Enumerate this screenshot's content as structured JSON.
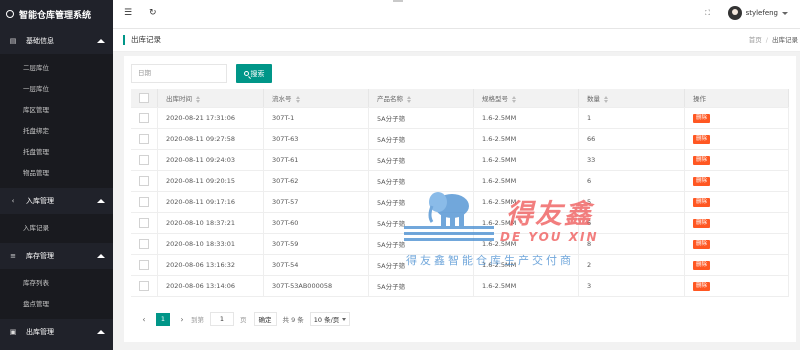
{
  "app": {
    "title": "智能仓库管理系统"
  },
  "sidebar": {
    "groups": [
      {
        "label": "基础信息",
        "icon": "document-icon",
        "items": [
          "二层库位",
          "一层库位",
          "库区管理",
          "托盘绑定",
          "托盘管理",
          "物品管理"
        ]
      },
      {
        "label": "入库管理",
        "icon": "chevron-left-icon",
        "items": [
          "入库记录"
        ]
      },
      {
        "label": "库存管理",
        "icon": "list-icon",
        "items": [
          "库存列表",
          "盘点管理"
        ]
      },
      {
        "label": "出库管理",
        "icon": "folder-icon",
        "items": []
      }
    ]
  },
  "topbar": {
    "menu_icon": "☰",
    "refresh_icon": "↻",
    "fullscreen_icon": "⛶",
    "user_name": "stylefeng"
  },
  "page": {
    "title": "出库记录",
    "breadcrumb": [
      "首页",
      "/",
      "出库记录"
    ]
  },
  "search": {
    "placeholder": "日期",
    "button_label": "搜索"
  },
  "table": {
    "columns": [
      "出库时间",
      "流水号",
      "产品名称",
      "规格型号",
      "数量",
      "操作"
    ],
    "action_label": "删除",
    "rows": [
      [
        "2020-08-21 17:31:06",
        "307T-1",
        "5A分子筛",
        "1.6-2.5MM",
        "1"
      ],
      [
        "2020-08-11 09:27:58",
        "307T-63",
        "5A分子筛",
        "1.6-2.5MM",
        "66"
      ],
      [
        "2020-08-11 09:24:03",
        "307T-61",
        "5A分子筛",
        "1.6-2.5MM",
        "33"
      ],
      [
        "2020-08-11 09:20:15",
        "307T-62",
        "5A分子筛",
        "1.6-2.5MM",
        "6"
      ],
      [
        "2020-08-11 09:17:16",
        "307T-57",
        "5A分子筛",
        "1.6-2.5MM",
        "5"
      ],
      [
        "2020-08-10 18:37:21",
        "307T-60",
        "5A分子筛",
        "1.6-2.5MM",
        "6"
      ],
      [
        "2020-08-10 18:33:01",
        "307T-59",
        "5A分子筛",
        "1.6-2.5MM",
        "8"
      ],
      [
        "2020-08-06 13:16:32",
        "307T-54",
        "5A分子筛",
        "1.6-2.5MM",
        "2"
      ],
      [
        "2020-08-06 13:14:06",
        "307T-53AB000058",
        "5A分子筛",
        "1.6-2.5MM",
        "3"
      ]
    ]
  },
  "pager": {
    "current": "1",
    "goto_label": "到第",
    "page_input": "1",
    "page_unit": "页",
    "ok_label": "确定",
    "total": "共 9 条",
    "page_size": "10 条/页"
  },
  "watermark": {
    "brand_cn": "得友鑫",
    "brand_en": "DE YOU XIN",
    "slogan": "得友鑫智能仓库生产交付商"
  },
  "colors": {
    "accent": "#009688",
    "danger": "#ff5722",
    "sidebar": "#20222a"
  }
}
